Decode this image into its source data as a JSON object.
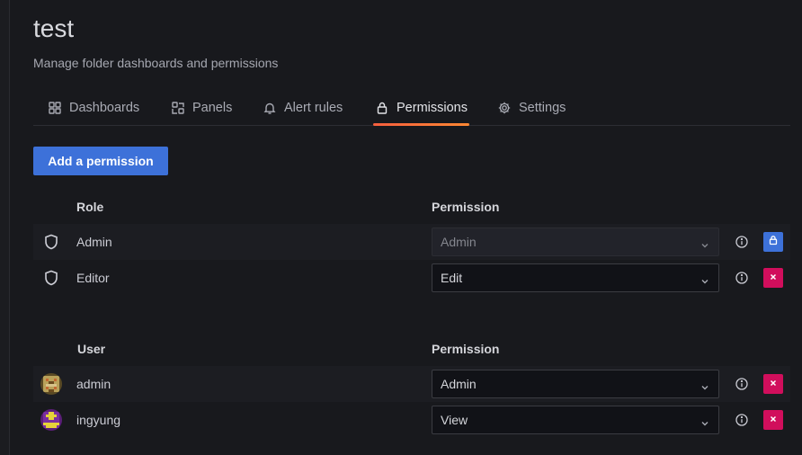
{
  "header": {
    "title": "test",
    "subtitle": "Manage folder dashboards and permissions"
  },
  "tabs": [
    {
      "label": "Dashboards",
      "icon": "apps-icon"
    },
    {
      "label": "Panels",
      "icon": "library-panel-icon"
    },
    {
      "label": "Alert rules",
      "icon": "bell-icon"
    },
    {
      "label": "Permissions",
      "icon": "lock-icon",
      "active": true
    },
    {
      "label": "Settings",
      "icon": "cog-icon"
    }
  ],
  "add_button_label": "Add a permission",
  "roles_section": {
    "name_header": "Role",
    "permission_header": "Permission",
    "items": [
      {
        "name": "Admin",
        "permission": "Admin",
        "locked": true
      },
      {
        "name": "Editor",
        "permission": "Edit",
        "locked": false
      }
    ]
  },
  "users_section": {
    "name_header": "User",
    "permission_header": "Permission",
    "items": [
      {
        "name": "admin",
        "permission": "Admin"
      },
      {
        "name": "ingyung",
        "permission": "View"
      }
    ]
  },
  "colors": {
    "accent": "#3d71d9",
    "danger": "#d10e5c",
    "tab_underline": "#f55f3e",
    "background": "#18191d"
  }
}
